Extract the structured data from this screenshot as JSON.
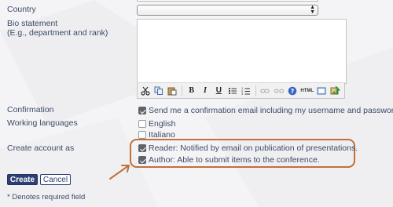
{
  "form": {
    "country_label": "Country",
    "country_value": "",
    "bio_label": "Bio statement",
    "bio_sublabel": "(E.g., department and rank)",
    "bio_value": "",
    "toolbar_buttons": [
      {
        "name": "cut-icon"
      },
      {
        "name": "copy-icon"
      },
      {
        "name": "paste-icon"
      },
      {
        "name": "bold-icon",
        "glyph": "B"
      },
      {
        "name": "italic-icon",
        "glyph": "I"
      },
      {
        "name": "underline-icon",
        "glyph": "U"
      },
      {
        "name": "bullet-list-icon"
      },
      {
        "name": "numbered-list-icon"
      },
      {
        "name": "link-icon"
      },
      {
        "name": "unlink-icon"
      },
      {
        "name": "help-icon",
        "glyph": "?"
      },
      {
        "name": "html-icon",
        "glyph": "HTML"
      },
      {
        "name": "fullscreen-icon"
      },
      {
        "name": "image-upload-icon"
      }
    ],
    "confirmation_label": "Confirmation",
    "confirmation_option": "Send me a confirmation email including my username and password",
    "confirmation_checked": true,
    "languages_label": "Working languages",
    "languages": [
      {
        "label": "English",
        "checked": false
      },
      {
        "label": "Italiano",
        "checked": false
      }
    ],
    "account_label": "Create account as",
    "roles": [
      {
        "label": "Reader: Notified by email on publication of presentations.",
        "checked": true
      },
      {
        "label": "Author: Able to submit items to the conference.",
        "checked": true
      }
    ],
    "create_button": "Create",
    "cancel_button": "Cancel",
    "footnote": "* Denotes required field"
  },
  "colors": {
    "accent": "#2b3f74",
    "highlight": "#c0703a",
    "text": "#3b4a66"
  }
}
